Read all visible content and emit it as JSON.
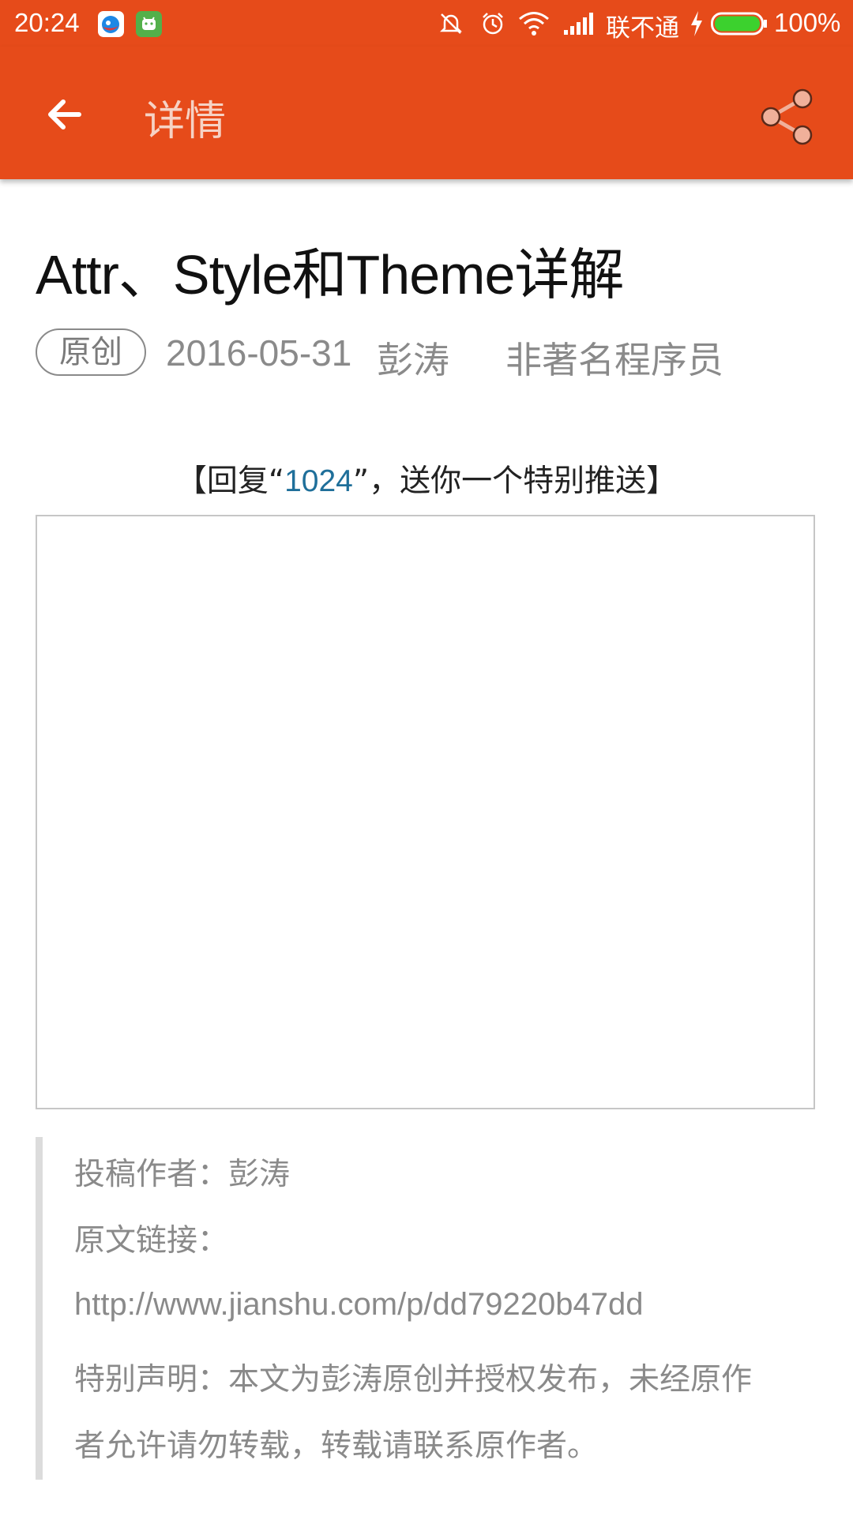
{
  "status_bar": {
    "time": "20:24",
    "carrier": "联不通",
    "battery": "100%",
    "battery_level": 1.0,
    "icons": [
      "app-icon-weibo",
      "app-icon-android",
      "mute-icon",
      "alarm-icon",
      "wifi-icon",
      "signal-icon",
      "charging-icon",
      "battery-icon"
    ]
  },
  "app_bar": {
    "title": "详情",
    "back_icon": "arrow-left-icon",
    "share_icon": "share-icon",
    "color": "#e64b1a"
  },
  "article": {
    "title": "Attr、Style和Theme详解",
    "badge": "原创",
    "date": "2016-05-31",
    "author": "彭涛",
    "source": "非著名程序员",
    "promo": {
      "prefix": "【回复“",
      "highlight": "1024",
      "suffix": "”，送你一个特别推送】"
    }
  },
  "quote": {
    "line1": "投稿作者：彭涛",
    "line2": "原文链接：",
    "link": "http://www.jianshu.com/p/dd79220b47dd",
    "line4": "特别声明：本文为彭涛原创并授权发布，未经原作",
    "line5": "者允许请勿转载，转载请联系原作者。"
  }
}
